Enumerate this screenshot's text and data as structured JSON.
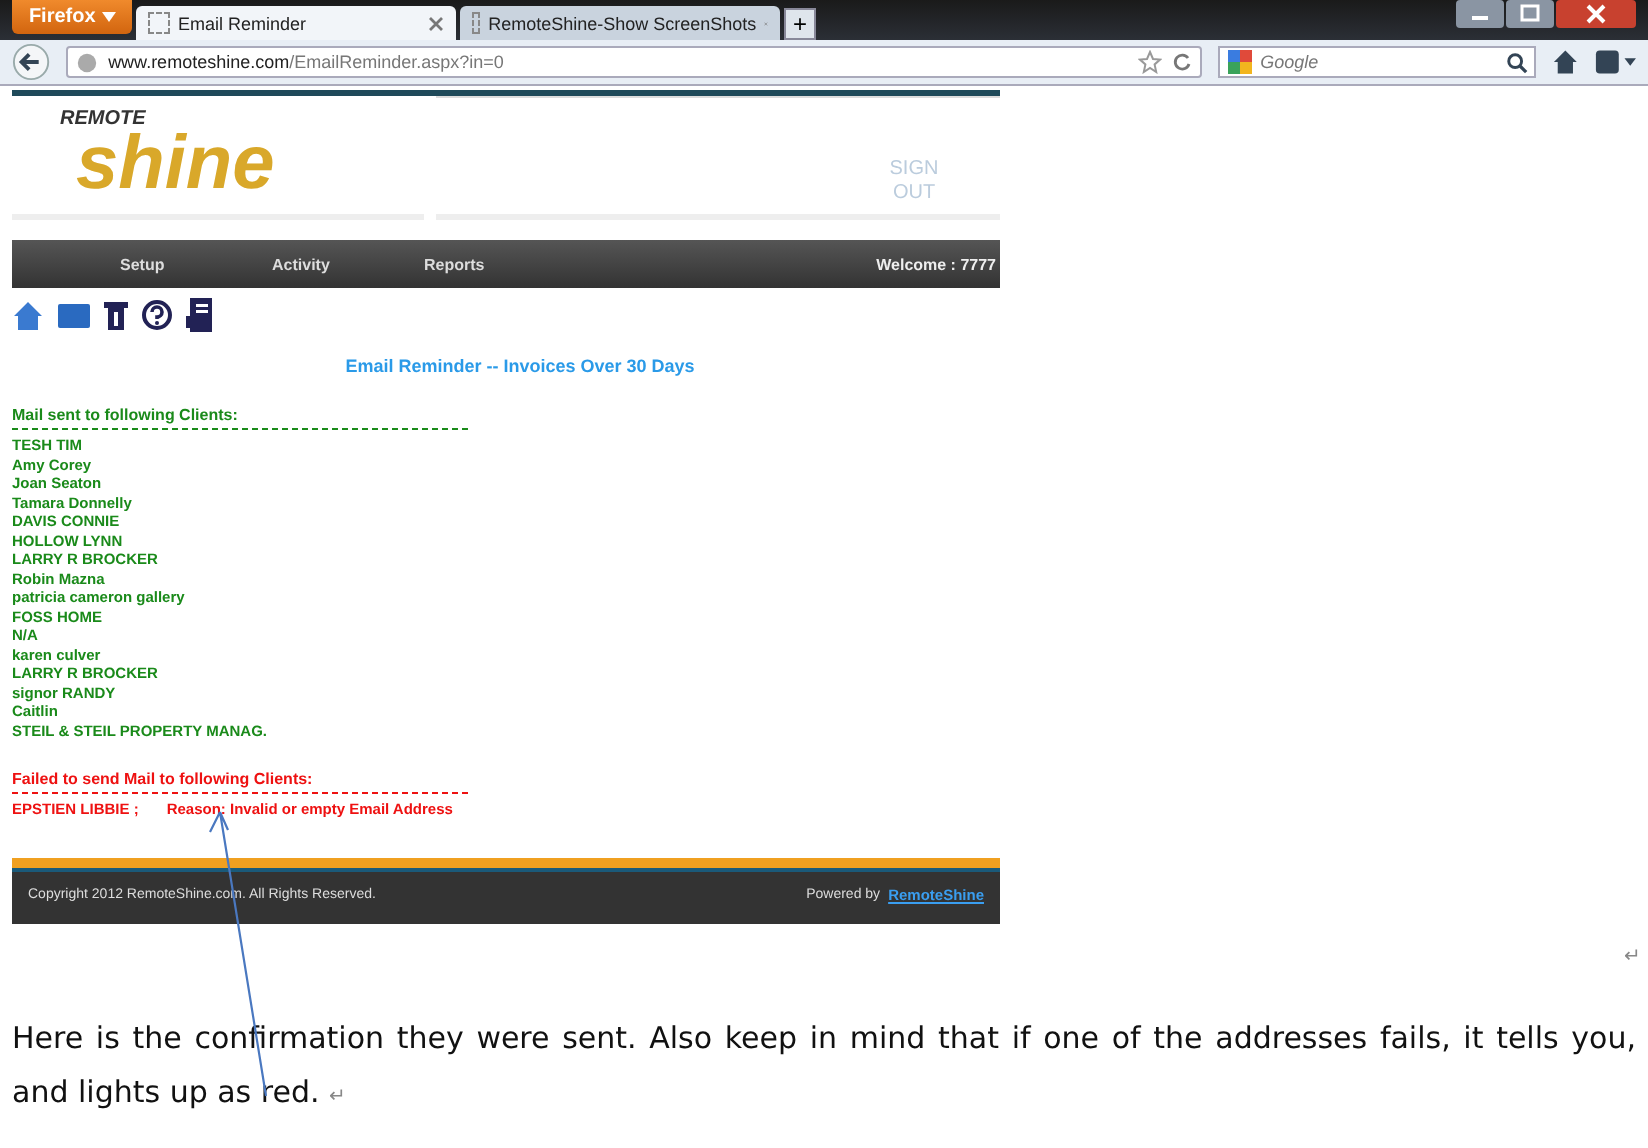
{
  "browser": {
    "menu_button": "Firefox",
    "tabs": [
      {
        "label": "Email Reminder",
        "selected": true
      },
      {
        "label": "RemoteShine-Show ScreenShots",
        "selected": false
      }
    ],
    "new_tab": "+",
    "url_domain": "www.remoteshine.com",
    "url_path": "/EmailReminder.aspx?in=0",
    "search_placeholder": "Google"
  },
  "site": {
    "logo_small": "REMOTE",
    "logo_big": "shine",
    "sign_out": "SIGN OUT",
    "nav": [
      "Setup",
      "Activity",
      "Reports"
    ],
    "welcome": "Welcome : 7777",
    "heading": "Email Reminder -- Invoices Over 30 Days",
    "sent_heading": "Mail sent to following Clients:",
    "sent_clients": [
      "TESH TIM",
      "Amy Corey",
      "Joan Seaton",
      "Tamara Donnelly",
      "DAVIS CONNIE",
      "HOLLOW LYNN",
      "LARRY R BROCKER",
      "Robin Mazna",
      "patricia cameron gallery",
      "FOSS HOME",
      "N/A",
      "karen culver",
      "LARRY R BROCKER",
      "signor RANDY",
      "Caitlin",
      "STEIL & STEIL PROPERTY MANAG."
    ],
    "failed_heading": "Failed to send Mail to following Clients:",
    "failed_clients": [
      {
        "name": "EPSTIEN LIBBIE ;",
        "reason": "Reason: Invalid or empty Email Address"
      }
    ],
    "footer": {
      "copyright": "Copyright 2012 RemoteShine.com. All Rights Reserved.",
      "powered_by": "Powered by",
      "link": "RemoteShine"
    }
  },
  "document": {
    "side_mark": "↵",
    "paragraph": "Here is the confirmation they were sent. Also keep in mind that if one of the addresses fails, it tells you, and lights up as red.",
    "paragraph_mark": "↵"
  }
}
